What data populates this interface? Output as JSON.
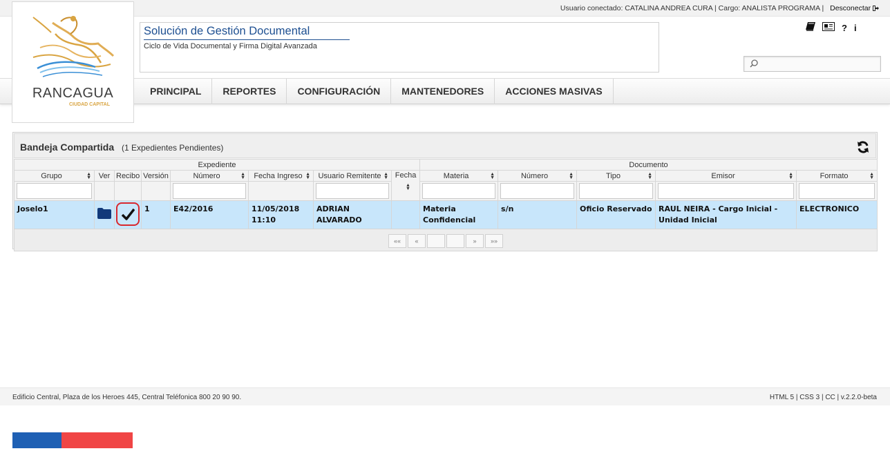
{
  "topbar": {
    "user_info": "Usuario conectado: CATALINA ANDREA CURA | Cargo: ANALISTA PROGRAMA |",
    "logout_label": "Desconectar"
  },
  "logo": {
    "name": "RANCAGUA",
    "subtitle": "CIUDAD CAPITAL"
  },
  "header": {
    "title": "Solución de Gestión Documental",
    "subtitle": "Ciclo de Vida Documental y Firma Digital Avanzada",
    "tools": [
      "book-icon",
      "newspaper-icon",
      "help-icon",
      "info-icon"
    ],
    "search_placeholder": ""
  },
  "nav": {
    "items": [
      "PRINCIPAL",
      "REPORTES",
      "CONFIGURACIÓN",
      "MANTENEDORES",
      "ACCIONES MASIVAS"
    ]
  },
  "panel": {
    "title": "Bandeja Compartida",
    "count": "(1 Expedientes Pendientes)",
    "groups": {
      "expediente": "Expediente",
      "documento": "Documento"
    },
    "columns": {
      "grupo": "Grupo",
      "ver": "Ver",
      "recibo": "Recibo",
      "version": "Versión",
      "numero": "Número",
      "fecha_ingreso": "Fecha Ingreso",
      "usuario_remitente": "Usuario Remitente",
      "fecha": "Fecha",
      "materia": "Materia",
      "doc_numero": "Número",
      "tipo": "Tipo",
      "emisor": "Emisor",
      "formato": "Formato"
    },
    "rows": [
      {
        "grupo": "Joselo1",
        "version": "1",
        "numero": "E42/2016",
        "fecha_ingreso": "11/05/2018 11:10",
        "usuario_remitente": "ADRIAN ALVARADO",
        "fecha": "",
        "materia": "Materia Confidencial",
        "doc_numero": "s/n",
        "tipo": "Oficio Reservado",
        "emisor": "RAUL NEIRA - Cargo Inicial - Unidad Inicial",
        "formato": "ELECTRONICO"
      }
    ],
    "pager": {
      "first": "««",
      "prev": "«",
      "next": "»",
      "last": "»»"
    }
  },
  "footer": {
    "address": "Edificio Central, Plaza de los Heroes 445, Central Teléfonica 800 20 90 90.",
    "version": "HTML 5 | CSS 3 | CC | v.2.2.0-beta"
  },
  "colors": {
    "brand_blue": "#1d4f91",
    "row_highlight": "#c8e6fb",
    "recibo_outline": "#d9262c",
    "flag_blue": "#1f60b4",
    "flag_red": "#f04545"
  }
}
